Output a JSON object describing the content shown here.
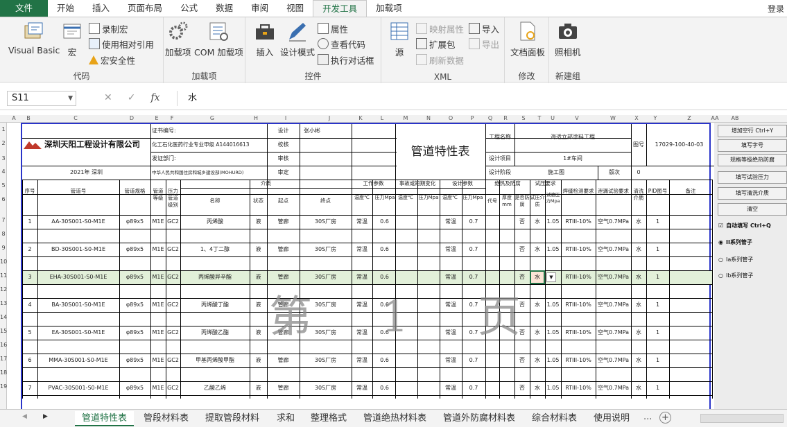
{
  "ribbon_tabs": [
    "文件",
    "开始",
    "插入",
    "页面布局",
    "公式",
    "数据",
    "审阅",
    "视图",
    "开发工具",
    "加载项"
  ],
  "login": "登录",
  "groups": {
    "code": {
      "label": "代码",
      "visual_basic": "Visual Basic",
      "macro": "宏",
      "record_macro": "录制宏",
      "relative_ref": "使用相对引用",
      "macro_security": "宏安全性"
    },
    "addins": {
      "label": "加载项",
      "addins": "加载项",
      "com_addins": "COM 加载项"
    },
    "controls": {
      "label": "控件",
      "insert": "插入",
      "design_mode": "设计模式",
      "properties": "属性",
      "view_code": "查看代码",
      "run_dialog": "执行对话框"
    },
    "xml": {
      "label": "XML",
      "source": "源",
      "map_properties": "映射属性",
      "expansion_packs": "扩展包",
      "refresh_data": "刷新数据",
      "import": "导入",
      "export": "导出"
    },
    "modify": {
      "label": "修改",
      "document_panel": "文档面板"
    },
    "new_group": {
      "label": "新建组",
      "camera": "照相机"
    }
  },
  "formula_bar": {
    "name_box": "S11",
    "value": "水"
  },
  "columns": [
    "A",
    "B",
    "C",
    "D",
    "E",
    "F",
    "G",
    "H",
    "I",
    "J",
    "K",
    "L",
    "M",
    "N",
    "O",
    "P",
    "Q",
    "R",
    "S",
    "T",
    "U",
    "V",
    "W",
    "X",
    "Y",
    "Z",
    "AA",
    "AB"
  ],
  "rows": [
    "1",
    "2",
    "3",
    "4",
    "5",
    "6",
    "7",
    "8",
    "9",
    "10",
    "11",
    "12",
    "13",
    "14",
    "15",
    "16",
    "17",
    "18",
    "19"
  ],
  "header": {
    "company": "深圳天阳工程设计有限公司",
    "year": "2021年 深圳",
    "cert_no_label": "证书编号:",
    "cert_text": "化工石化医药行业专业甲级 A144016613",
    "issuer_label": "发证部门:",
    "issuer_text": "中华人民共和国住房和城乡建设部(MOHURD)",
    "design": "设计",
    "designer": "张小彬",
    "check": "校核",
    "review": "审核",
    "approve": "审定",
    "table_title": "管道特性表",
    "project_label": "工程名称",
    "project_name": "海适立邦涂料工程",
    "design_item_label": "设计项目",
    "design_item": "1#车间",
    "stage_label": "设计阶段",
    "stage": "施工图",
    "version_label": "版次",
    "version": "0",
    "drawing_no_label": "图号",
    "drawing_no": "17029-100-40-03"
  },
  "col_headers": {
    "seq": "序号",
    "pipe_no": "管道号",
    "spec": "管道规格",
    "grade": "管道等级",
    "pressure_grade": "压力管道级别",
    "medium": "介质",
    "name": "名称",
    "state": "状态",
    "start": "起点",
    "end": "终点",
    "working": "工作参数",
    "accident": "事故或短期变化",
    "design_params": "设计参数",
    "temp": "温度℃",
    "press": "压力Mpa",
    "insulation": "绝热及防腐",
    "code": "代号",
    "thickness": "厚度mm",
    "anticorr": "是否防腐",
    "test": "试压要求",
    "test_medium": "试压介质",
    "test_press": "试验压力Mpa",
    "ndt": "焊缝检测要求",
    "leak": "泄漏试验要求",
    "clean": "清洗介质",
    "pid": "PID图号",
    "remark": "备注"
  },
  "data_rows": [
    {
      "seq": "1",
      "pipe": "AA-30S001-S0-M1E",
      "spec": "φ89x5",
      "grade": "M1E",
      "pg": "GC2",
      "name": "丙烯酸",
      "state": "液",
      "start": "管廊",
      "end": "30S厂房",
      "wt": "常温",
      "wp": "0.6",
      "dt": "常温",
      "dp": "0.7",
      "ac": "否",
      "tm": "水",
      "tp": "1.05",
      "ndt": "RTIII-10%",
      "leak": "空气0.7MPa",
      "clean": "水",
      "pid": "1"
    },
    {
      "seq": "2",
      "pipe": "BD-30S001-S0-M1E",
      "spec": "φ89x5",
      "grade": "M1E",
      "pg": "GC2",
      "name": "1、4丁二醇",
      "state": "液",
      "start": "管廊",
      "end": "30S厂房",
      "wt": "常温",
      "wp": "0.6",
      "dt": "常温",
      "dp": "0.7",
      "ac": "否",
      "tm": "水",
      "tp": "1.05",
      "ndt": "RTIII-10%",
      "leak": "空气0.7MPa",
      "clean": "水",
      "pid": "1"
    },
    {
      "seq": "3",
      "pipe": "EHA-30S001-S0-M1E",
      "spec": "φ89x5",
      "grade": "M1E",
      "pg": "GC2",
      "name": "丙烯酸异辛酯",
      "state": "液",
      "start": "管廊",
      "end": "30S厂房",
      "wt": "常温",
      "wp": "0.6",
      "dt": "常温",
      "dp": "0.7",
      "ac": "否",
      "tm": "水",
      "tp": "",
      "ndt": "RTIII-10%",
      "leak": "空气0.7MPa",
      "clean": "水",
      "pid": "1"
    },
    {
      "seq": "4",
      "pipe": "BA-30S001-S0-M1E",
      "spec": "φ89x5",
      "grade": "M1E",
      "pg": "GC2",
      "name": "丙烯酸丁酯",
      "state": "液",
      "start": "管廊",
      "end": "30S厂房",
      "wt": "常温",
      "wp": "0.6",
      "dt": "常温",
      "dp": "0.7",
      "ac": "否",
      "tm": "水",
      "tp": "1.05",
      "ndt": "RTIII-10%",
      "leak": "空气0.7MPa",
      "clean": "水",
      "pid": "1"
    },
    {
      "seq": "5",
      "pipe": "EA-30S001-S0-M1E",
      "spec": "φ89x5",
      "grade": "M1E",
      "pg": "GC2",
      "name": "丙烯酸乙酯",
      "state": "液",
      "start": "管廊",
      "end": "30S厂房",
      "wt": "常温",
      "wp": "0.6",
      "dt": "常温",
      "dp": "0.7",
      "ac": "否",
      "tm": "水",
      "tp": "1.05",
      "ndt": "RTIII-10%",
      "leak": "空气0.7MPa",
      "clean": "水",
      "pid": "1"
    },
    {
      "seq": "6",
      "pipe": "MMA-30S001-S0-M1E",
      "spec": "φ89x5",
      "grade": "M1E",
      "pg": "GC2",
      "name": "甲基丙烯酸甲酯",
      "state": "液",
      "start": "管廊",
      "end": "30S厂房",
      "wt": "常温",
      "wp": "0.6",
      "dt": "常温",
      "dp": "0.7",
      "ac": "否",
      "tm": "水",
      "tp": "1.05",
      "ndt": "RTIII-10%",
      "leak": "空气0.7MPa",
      "clean": "水",
      "pid": "1"
    },
    {
      "seq": "7",
      "pipe": "PVAC-30S001-S0-M1E",
      "spec": "φ89x5",
      "grade": "M1E",
      "pg": "GC2",
      "name": "乙酸乙烯",
      "state": "液",
      "start": "管廊",
      "end": "30S厂房",
      "wt": "常温",
      "wp": "0.6",
      "dt": "常温",
      "dp": "0.7",
      "ac": "否",
      "tm": "水",
      "tp": "1.05",
      "ndt": "RTIII-10%",
      "leak": "空气0.7MPa",
      "clean": "水",
      "pid": "1"
    }
  ],
  "watermark": "第 1 页",
  "panel_buttons": [
    "增加空行 Ctrl+Y",
    "填写字号",
    "规格等级绝热防腐",
    "填写试验压力",
    "填写清洗介质",
    "清空"
  ],
  "panel_options": {
    "auto_fill": "自动填写 Ctrl+Q",
    "series2": "II系列管子",
    "series1a": "Ia系列管子",
    "series1b": "Ib系列管子"
  },
  "sheet_tabs": [
    "管道特性表",
    "管段材料表",
    "提取管段材料",
    "求和",
    "整理格式",
    "管道绝热材料表",
    "管道外防腐材料表",
    "综合材料表",
    "使用说明"
  ],
  "more_tabs": "...",
  "colors": {
    "excel_green": "#217346",
    "selection_row": "#e2f0d9",
    "border_blue": "#2a34c9"
  }
}
